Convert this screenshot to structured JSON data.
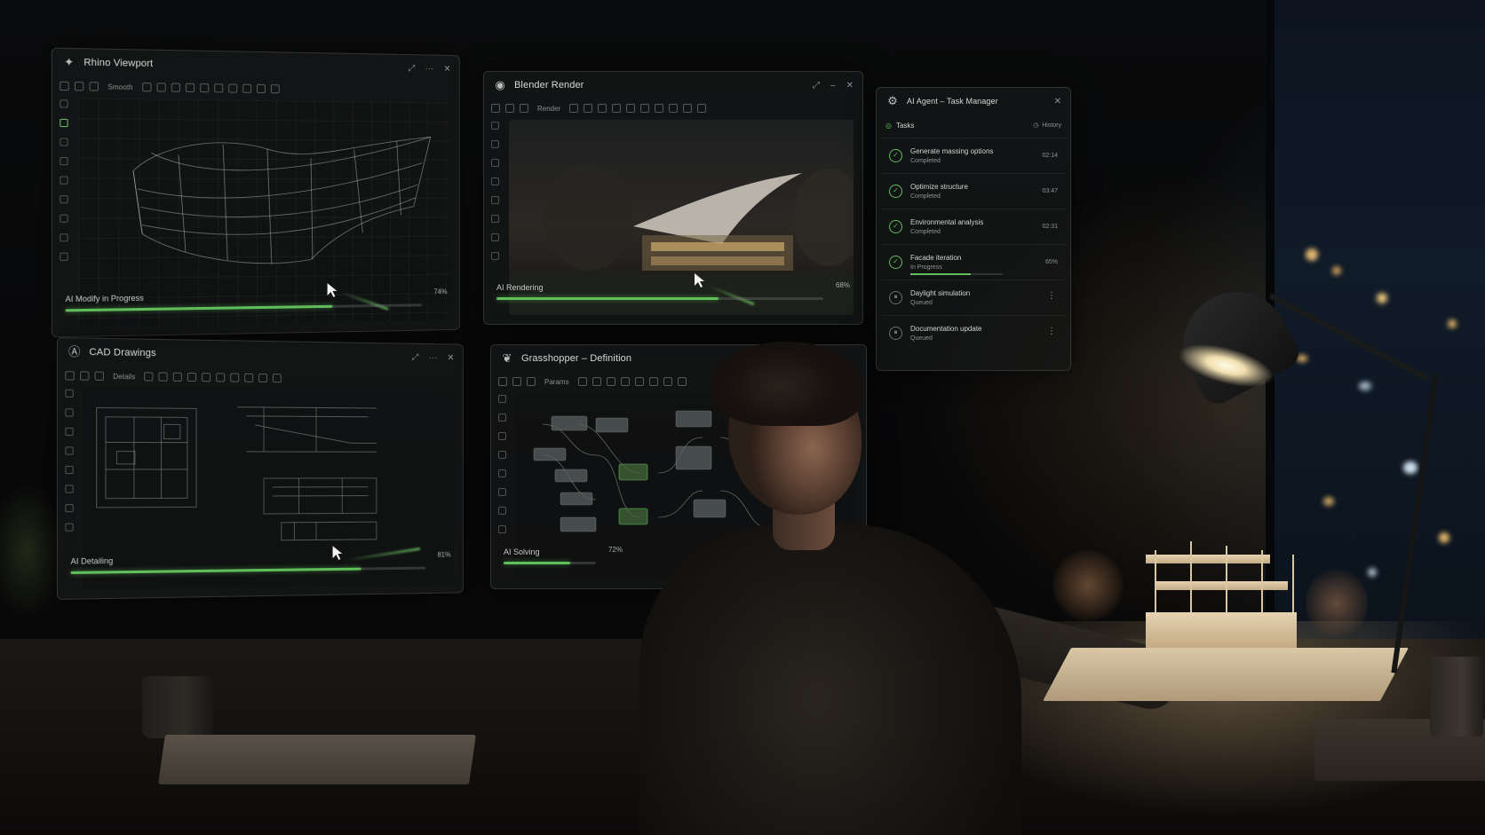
{
  "panels": {
    "rhino": {
      "title": "Rhino Viewport",
      "toolbar_text": "Smooth",
      "progress_label": "AI Modify in Progress",
      "progress_pct_text": "74%",
      "progress": 0.74
    },
    "blender": {
      "title": "Blender Render",
      "toolbar_text": "Render",
      "progress_label": "AI Rendering",
      "progress_pct_text": "68%",
      "progress": 0.68
    },
    "cad": {
      "title": "CAD Drawings",
      "toolbar_text": "Details",
      "progress_label": "AI Detailing",
      "progress_pct_text": "81%",
      "progress": 0.81
    },
    "grasshopper": {
      "title": "Grasshopper – Definition",
      "toolbar_text": "Params",
      "progress_label": "AI Solving",
      "progress_pct_text": "72%",
      "progress": 0.72
    }
  },
  "task_manager": {
    "title": "AI Agent – Task Manager",
    "tab_tasks": "Tasks",
    "tab_history": "History",
    "tasks": [
      {
        "name": "Generate massing options",
        "state": "Completed",
        "time": "02:14",
        "status": "done"
      },
      {
        "name": "Optimize structure",
        "state": "Completed",
        "time": "03:47",
        "status": "done"
      },
      {
        "name": "Environmental analysis",
        "state": "Completed",
        "time": "02:31",
        "status": "done"
      },
      {
        "name": "Facade iteration",
        "state": "In Progress",
        "time": "65%",
        "status": "progress",
        "progress": 0.65
      },
      {
        "name": "Daylight simulation",
        "state": "Queued",
        "time": "",
        "status": "queued"
      },
      {
        "name": "Documentation update",
        "state": "Queued",
        "time": "",
        "status": "queued"
      }
    ]
  },
  "icons": {
    "check": "✓",
    "more": "⋮",
    "close": "✕",
    "minimize": "–",
    "ellipsis": "···"
  },
  "colors": {
    "accent_green": "#5fbf5a",
    "panel_bg": "#161818"
  }
}
